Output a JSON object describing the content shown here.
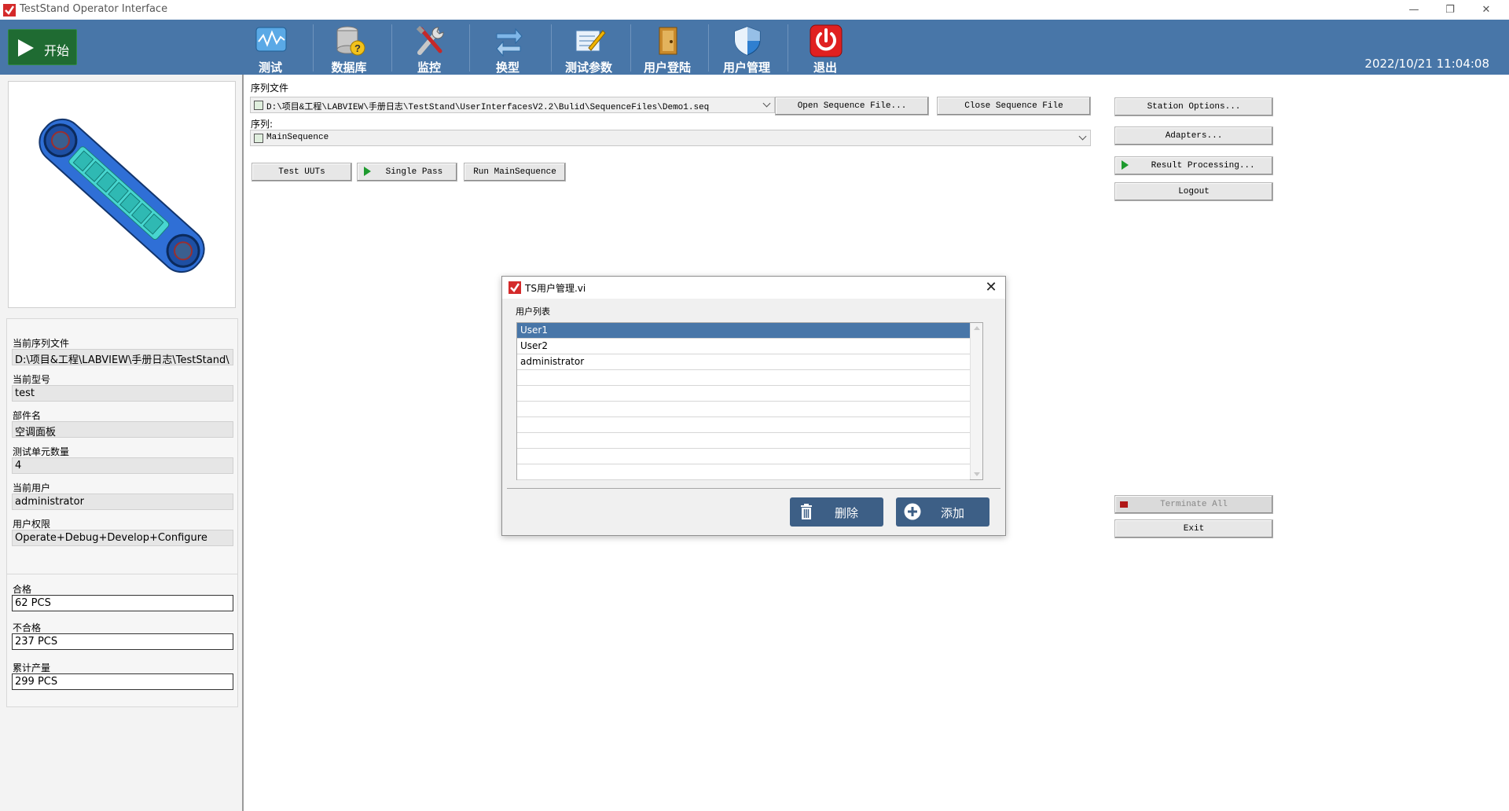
{
  "window": {
    "title": "TestStand Operator Interface",
    "controls": {
      "minimize": "—",
      "restore": "❐",
      "close": "✕"
    }
  },
  "toolbar": {
    "start_label": "开始",
    "items": [
      {
        "label": "测试",
        "icon": "chart-monitor-icon"
      },
      {
        "label": "数据库",
        "icon": "database-question-icon"
      },
      {
        "label": "监控",
        "icon": "tools-icon"
      },
      {
        "label": "换型",
        "icon": "swap-arrows-icon"
      },
      {
        "label": "测试参数",
        "icon": "edit-params-icon"
      },
      {
        "label": "用户登陆",
        "icon": "door-login-icon"
      },
      {
        "label": "用户管理",
        "icon": "shield-user-icon"
      },
      {
        "label": "退出",
        "icon": "power-icon"
      }
    ],
    "datetime": "2022/10/21 11:04:08"
  },
  "left_panel": {
    "fields": [
      {
        "label": "当前序列文件",
        "value": "D:\\项目&工程\\LABVIEW\\手册日志\\TestStand\\"
      },
      {
        "label": "当前型号",
        "value": "test"
      },
      {
        "label": "部件名",
        "value": "空调面板"
      },
      {
        "label": "测试单元数量",
        "value": "4"
      },
      {
        "label": "当前用户",
        "value": "administrator"
      },
      {
        "label": "用户权限",
        "value": "Operate+Debug+Develop+Configure"
      }
    ],
    "counters": [
      {
        "label": "合格",
        "value": "62 PCS"
      },
      {
        "label": "不合格",
        "value": "237 PCS"
      },
      {
        "label": "累计产量",
        "value": "299 PCS"
      }
    ]
  },
  "main": {
    "seqfile_label": "序列文件",
    "seqfile_path": "D:\\项目&工程\\LABVIEW\\手册日志\\TestStand\\UserInterfacesV2.2\\Bulid\\SequenceFiles\\Demo1.seq",
    "sequence_label": "序列:",
    "sequence_value": "MainSequence",
    "buttons": {
      "open_seq": "Open Sequence File...",
      "close_seq": "Close Sequence File",
      "test_uuts": "Test UUTs",
      "single_pass": "Single Pass",
      "run_main": "Run MainSequence",
      "station_options": "Station Options...",
      "adapters": "Adapters...",
      "result_processing": "Result Processing...",
      "logout": "Logout",
      "terminate_all": "Terminate All",
      "exit": "Exit"
    }
  },
  "dialog": {
    "title": "TS用户管理.vi",
    "list_caption": "用户列表",
    "users": [
      "User1",
      "User2",
      "administrator",
      "",
      "",
      "",
      "",
      "",
      "",
      ""
    ],
    "selected_index": 0,
    "delete_label": "删除",
    "add_label": "添加"
  },
  "colors": {
    "toolbar_bg": "#4876a8",
    "start_bg": "#1f6b32",
    "selection": "#4876a8",
    "dialog_button": "#3d5f86"
  }
}
